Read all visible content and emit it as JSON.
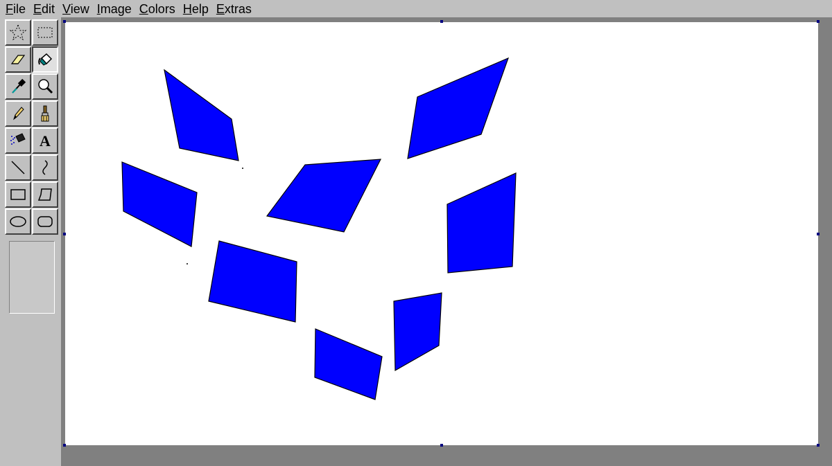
{
  "menu": {
    "items": [
      {
        "first": "F",
        "rest": "ile"
      },
      {
        "first": "E",
        "rest": "dit"
      },
      {
        "first": "V",
        "rest": "iew"
      },
      {
        "first": "I",
        "rest": "mage"
      },
      {
        "first": "C",
        "rest": "olors"
      },
      {
        "first": "H",
        "rest": "elp"
      },
      {
        "first": "E",
        "rest": "xtras"
      }
    ]
  },
  "toolbox": {
    "tools": [
      {
        "name": "free-form-select-tool",
        "icon": "star-select-icon",
        "selected": false
      },
      {
        "name": "rectangle-select-tool",
        "icon": "dashed-rect-icon",
        "selected": false
      },
      {
        "name": "eraser-tool",
        "icon": "eraser-icon",
        "selected": false
      },
      {
        "name": "fill-tool",
        "icon": "paint-bucket-icon",
        "selected": true
      },
      {
        "name": "color-picker-tool",
        "icon": "eyedropper-icon",
        "selected": false
      },
      {
        "name": "magnifier-tool",
        "icon": "magnifier-icon",
        "selected": false
      },
      {
        "name": "pencil-tool",
        "icon": "pencil-icon",
        "selected": false
      },
      {
        "name": "brush-tool",
        "icon": "brush-icon",
        "selected": false
      },
      {
        "name": "airbrush-tool",
        "icon": "airbrush-icon",
        "selected": false
      },
      {
        "name": "text-tool",
        "icon": "text-a-icon",
        "label": "A",
        "selected": false
      },
      {
        "name": "line-tool",
        "icon": "line-icon",
        "selected": false
      },
      {
        "name": "curve-tool",
        "icon": "curve-icon",
        "selected": false
      },
      {
        "name": "rectangle-tool",
        "icon": "rectangle-icon",
        "selected": false
      },
      {
        "name": "polygon-tool",
        "icon": "polygon-icon",
        "selected": false
      },
      {
        "name": "ellipse-tool",
        "icon": "ellipse-icon",
        "selected": false
      },
      {
        "name": "rounded-rectangle-tool",
        "icon": "rounded-rect-icon",
        "selected": false
      }
    ]
  },
  "canvas": {
    "background": "#ffffff",
    "shape_fill": "#0000ff",
    "shape_stroke": "#000000"
  }
}
